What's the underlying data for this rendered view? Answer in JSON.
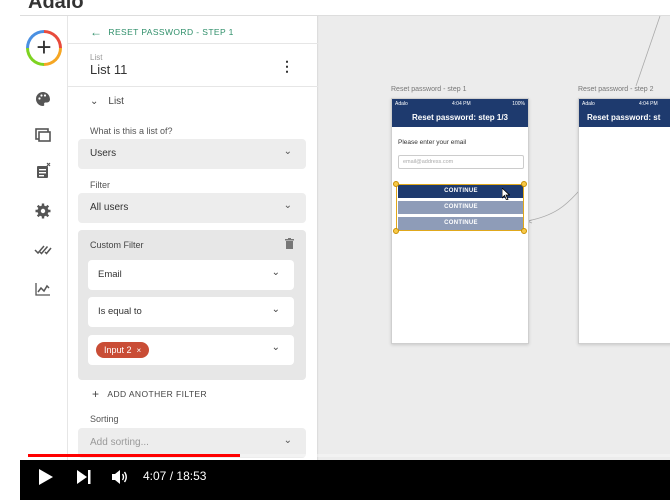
{
  "app": {
    "logo": "Adalo"
  },
  "sidebar_icons": [
    "add-component-icon",
    "palette-icon",
    "screens-icon",
    "database-icon",
    "settings-icon",
    "publish-icon",
    "analytics-icon"
  ],
  "panel": {
    "back_label": "RESET PASSWORD - STEP 1",
    "kicker": "List",
    "title": "List 11",
    "section": "List",
    "list_of_label": "What is this a list of?",
    "list_of_value": "Users",
    "filter_label": "Filter",
    "filter_value": "All users",
    "custom_filter": {
      "label": "Custom Filter",
      "field": "Email",
      "operator": "Is equal to",
      "value_chip": "Input 2",
      "chip_remove": "×"
    },
    "add_filter": "ADD ANOTHER FILTER",
    "sorting_label": "Sorting",
    "sorting_placeholder": "Add sorting..."
  },
  "canvas": {
    "screen1": {
      "label": "Reset password - step 1",
      "carrier": "Adalo",
      "time": "4:04 PM",
      "battery": "100%",
      "title": "Reset password: step 1/3",
      "prompt": "Please enter your email",
      "input_placeholder": "email@address.com",
      "buttons": [
        "CONTINUE",
        "CONTINUE",
        "CONTINUE"
      ]
    },
    "screen2": {
      "label": "Reset password - step 2",
      "carrier": "Adalo",
      "time": "4:04 PM",
      "title": "Reset password: st"
    }
  },
  "player": {
    "current_time": "4:07",
    "separator": "/",
    "duration": "18:53",
    "progress_fraction": 0.33,
    "accent": "#ff0000"
  },
  "colors": {
    "phone_header": "#1e3a6e",
    "selected_button": "#1e3a6e",
    "other_buttons": "#8e9cb8",
    "chip": "#c94d36",
    "back_link": "#2f8f6a"
  }
}
